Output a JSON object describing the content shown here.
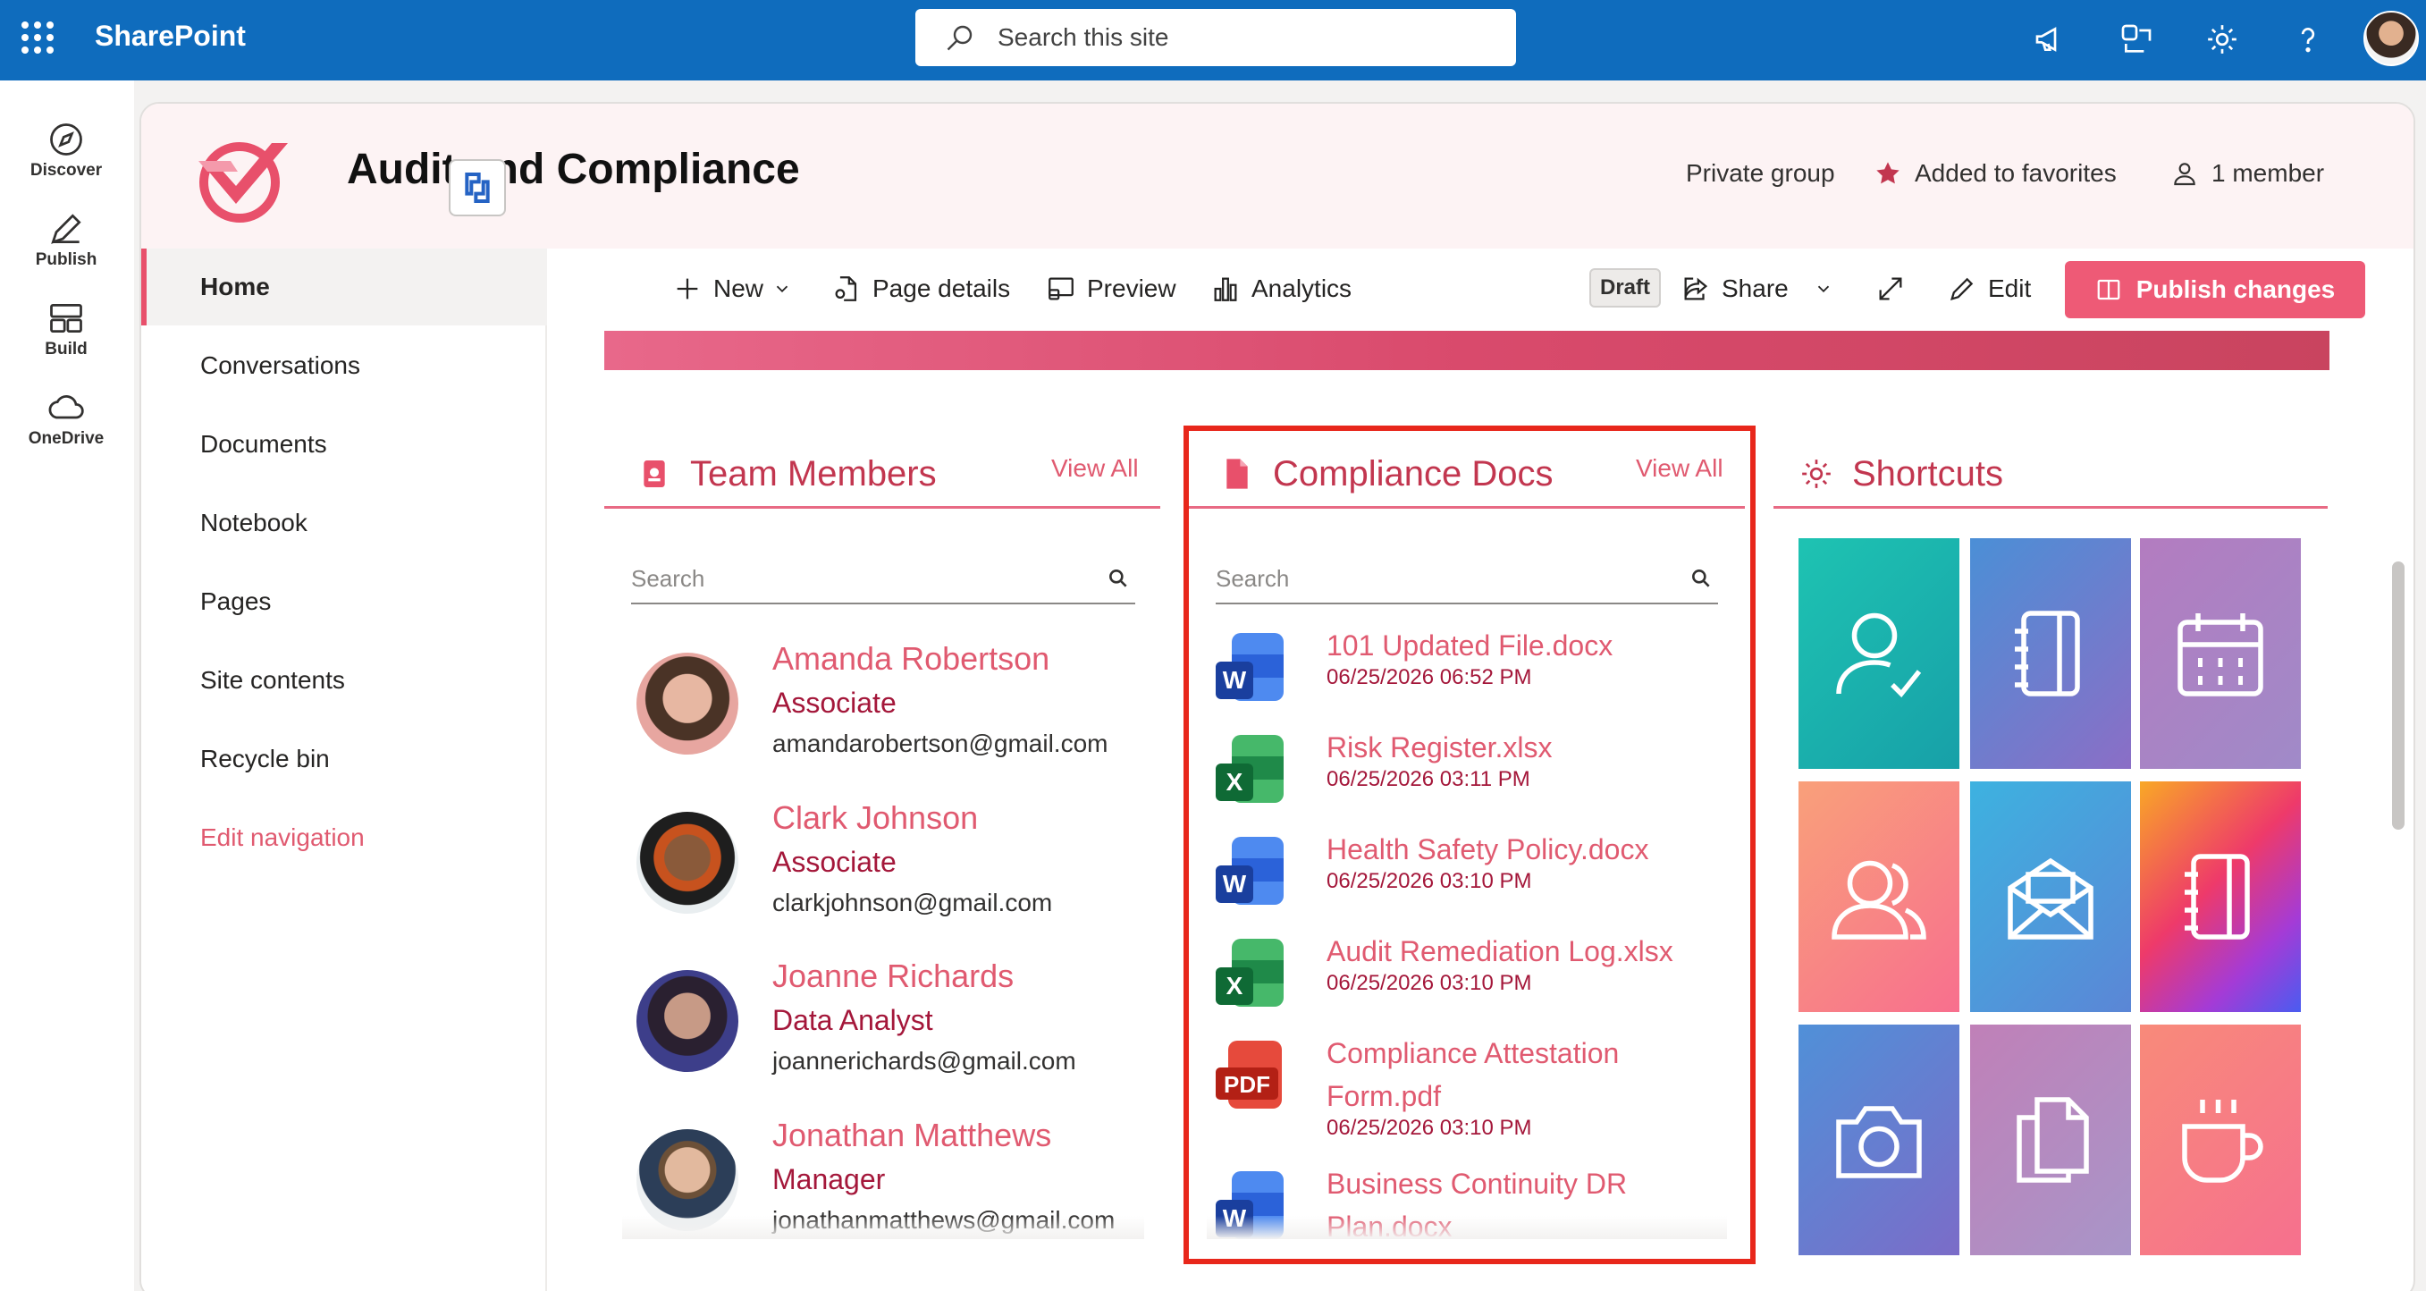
{
  "suite": {
    "app_name": "SharePoint",
    "search_placeholder": "Search this site"
  },
  "appbar": {
    "items": [
      {
        "label": "Discover"
      },
      {
        "label": "Publish"
      },
      {
        "label": "Build"
      },
      {
        "label": "OneDrive"
      }
    ]
  },
  "site": {
    "title": "Audit and Compliance",
    "privacy": "Private group",
    "favorites": "Added to favorites",
    "members": "1 member"
  },
  "nav": {
    "items": [
      "Home",
      "Conversations",
      "Documents",
      "Notebook",
      "Pages",
      "Site contents",
      "Recycle bin"
    ],
    "edit_label": "Edit navigation"
  },
  "commands": {
    "new": "New",
    "page_details": "Page details",
    "preview": "Preview",
    "analytics": "Analytics",
    "status": "Draft",
    "share": "Share",
    "edit": "Edit",
    "publish": "Publish changes"
  },
  "team": {
    "title": "Team Members",
    "view_all": "View All",
    "search_placeholder": "Search",
    "members": [
      {
        "name": "Amanda Robertson",
        "role": "Associate",
        "email": "amandarobertson@gmail.com"
      },
      {
        "name": "Clark Johnson",
        "role": "Associate",
        "email": "clarkjohnson@gmail.com"
      },
      {
        "name": "Joanne Richards",
        "role": "Data Analyst",
        "email": "joannerichards@gmail.com"
      },
      {
        "name": "Jonathan Matthews",
        "role": "Manager",
        "email": "jonathanmatthews@gmail.com"
      }
    ]
  },
  "docs": {
    "title": "Compliance Docs",
    "view_all": "View All",
    "search_placeholder": "Search",
    "files": [
      {
        "name": "101 Updated File.docx",
        "date": "06/25/2026 06:52 PM",
        "type": "word"
      },
      {
        "name": "Risk Register.xlsx",
        "date": "06/25/2026 03:11 PM",
        "type": "excel"
      },
      {
        "name": "Health Safety Policy.docx",
        "date": "06/25/2026 03:10 PM",
        "type": "word"
      },
      {
        "name": "Audit Remediation Log.xlsx",
        "date": "06/25/2026 03:10 PM",
        "type": "excel"
      },
      {
        "name": "Compliance Attestation Form.pdf",
        "date": "06/25/2026 03:10 PM",
        "type": "pdf"
      },
      {
        "name": "Business Continuity DR Plan.docx",
        "date": "",
        "type": "word"
      }
    ]
  },
  "shortcuts": {
    "title": "Shortcuts",
    "tiles": [
      {
        "icon": "person-check-icon",
        "color": "#1fb5a6"
      },
      {
        "icon": "notebook-icon",
        "color": "#6b7fc8"
      },
      {
        "icon": "calendar-icon",
        "color": "#b07fc0"
      },
      {
        "icon": "people-icon",
        "color": "#f7908a"
      },
      {
        "icon": "mail-open-icon",
        "color": "#4aa0e0"
      },
      {
        "icon": "notebook-icon",
        "color": "#d8348a"
      },
      {
        "icon": "camera-icon",
        "color": "#5a7fd0"
      },
      {
        "icon": "documents-icon",
        "color": "#c080b8"
      },
      {
        "icon": "coffee-icon",
        "color": "#f88a8a"
      }
    ]
  },
  "colors": {
    "brand": "#0f6cbd",
    "accent": "#e05a70",
    "highlight": "#e8271b"
  }
}
